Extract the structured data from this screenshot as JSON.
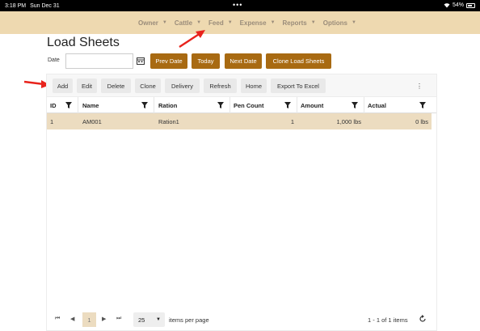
{
  "status_bar": {
    "time": "3:18 PM",
    "date": "Sun Dec 31",
    "battery": "54%"
  },
  "nav": {
    "items": [
      {
        "label": "Owner"
      },
      {
        "label": "Cattle"
      },
      {
        "label": "Feed"
      },
      {
        "label": "Expense"
      },
      {
        "label": "Reports"
      },
      {
        "label": "Options"
      }
    ]
  },
  "page": {
    "title": "Load Sheets"
  },
  "date_filter": {
    "label": "Date",
    "value": ""
  },
  "date_buttons": {
    "prev": "Prev Date",
    "today": "Today",
    "next": "Next Date",
    "clone": "Clone Load Sheets"
  },
  "toolbar": {
    "add": "Add",
    "edit": "Edit",
    "delete": "Delete",
    "clone": "Clone",
    "delivery": "Delivery",
    "refresh": "Refresh",
    "home": "Home",
    "export": "Export To Excel",
    "more": "⋮"
  },
  "table": {
    "columns": [
      "ID",
      "Name",
      "Ration",
      "Pen Count",
      "Amount",
      "Actual"
    ],
    "rows": [
      {
        "id": "1",
        "name": "AM001",
        "ration": "Ration1",
        "pen_count": "1",
        "amount": "1,000 lbs",
        "actual": "0 lbs"
      }
    ]
  },
  "pager": {
    "current_page": "1",
    "page_size": "25",
    "items_per_page_label": "items per page",
    "range": "1 - 1 of 1 items"
  }
}
